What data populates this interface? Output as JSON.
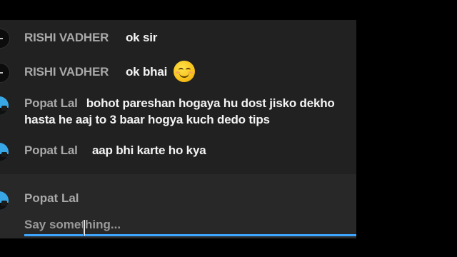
{
  "chat": {
    "messages": [
      {
        "author": "RISHI VADHER",
        "text": "ok sir",
        "avatar_icon": "user-avatar-dark-icon"
      },
      {
        "author": "RISHI VADHER",
        "text": "ok bhai",
        "avatar_icon": "user-avatar-dark-icon",
        "emoji": "smiling-face-emoji"
      },
      {
        "author": "Popat Lal",
        "text": "bohot pareshan hogaya hu dost jisko dekho hasta he aaj to 3 baar hogya kuch dedo tips",
        "avatar_icon": "user-avatar-sky-icon"
      },
      {
        "author": "Popat Lal",
        "text": "aap bhi karte ho kya",
        "avatar_icon": "user-avatar-sky-icon"
      }
    ]
  },
  "composer": {
    "author": "Popat Lal",
    "placeholder": "Say something...",
    "avatar_icon": "user-avatar-sky-icon"
  },
  "colors": {
    "background": "#000000",
    "panel": "#212121",
    "composer_bg": "#282828",
    "author_text": "#a9a9a9",
    "message_text": "#f4f4f4",
    "accent_underline": "#3ea6ff"
  }
}
